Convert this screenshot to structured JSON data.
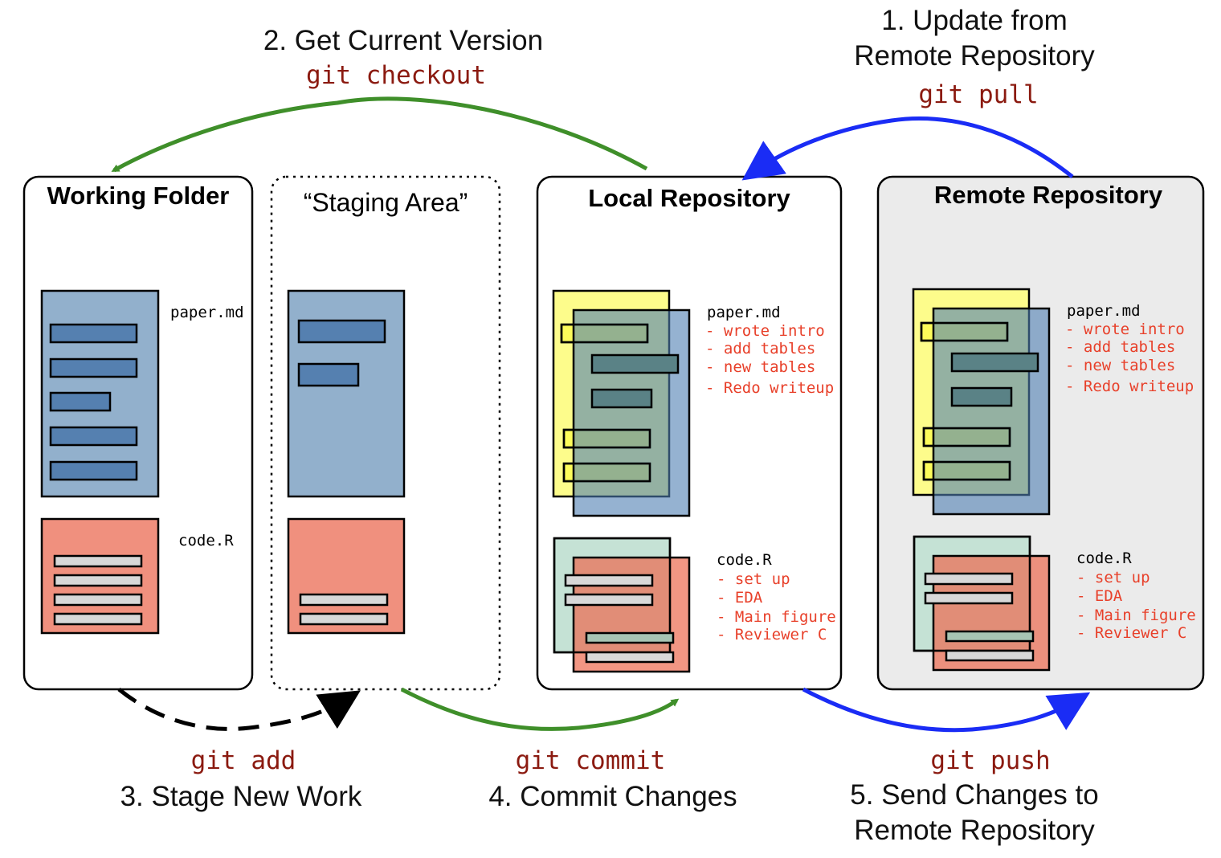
{
  "steps": {
    "get_current": {
      "label": "2. Get Current Version",
      "command": "git checkout"
    },
    "update_remote": {
      "label_line1": "1. Update from",
      "label_line2": "Remote Repository",
      "command": "git pull"
    },
    "stage": {
      "label": "3. Stage New Work",
      "command": "git add"
    },
    "commit": {
      "label": "4. Commit Changes",
      "command": "git commit"
    },
    "push": {
      "label_line1": "5. Send Changes to",
      "label_line2": "Remote Repository",
      "command": "git push"
    }
  },
  "areas": {
    "working": {
      "title": "Working Folder",
      "file1": "paper.md",
      "file2": "code.R"
    },
    "staging": {
      "title": "“Staging Area”"
    },
    "local": {
      "title": "Local Repository",
      "file1": "paper.md",
      "file1_history": [
        "- wrote intro",
        "- add tables",
        "- new tables",
        "- Redo writeup"
      ],
      "file2": "code.R",
      "file2_history": [
        "- set up",
        "- EDA",
        "- Main figure",
        "- Reviewer C"
      ]
    },
    "remote": {
      "title": "Remote Repository",
      "file1": "paper.md",
      "file1_history": [
        "- wrote intro",
        "- add tables",
        "- new tables",
        "- Redo writeup"
      ],
      "file2": "code.R",
      "file2_history": [
        "- set up",
        "- EDA",
        "- Main figure",
        "- Reviewer C"
      ]
    }
  },
  "colors": {
    "green_arrow": "#3f8f2a",
    "blue_arrow": "#1a2cf5",
    "command_text": "#8b1a10",
    "history_text": "#e8402a",
    "doc_blue": "#92b0cc",
    "doc_red": "#f0907e",
    "doc_yellow": "#fdfc8b",
    "doc_green": "#c5e2d5",
    "remote_bg": "#ebebeb"
  }
}
